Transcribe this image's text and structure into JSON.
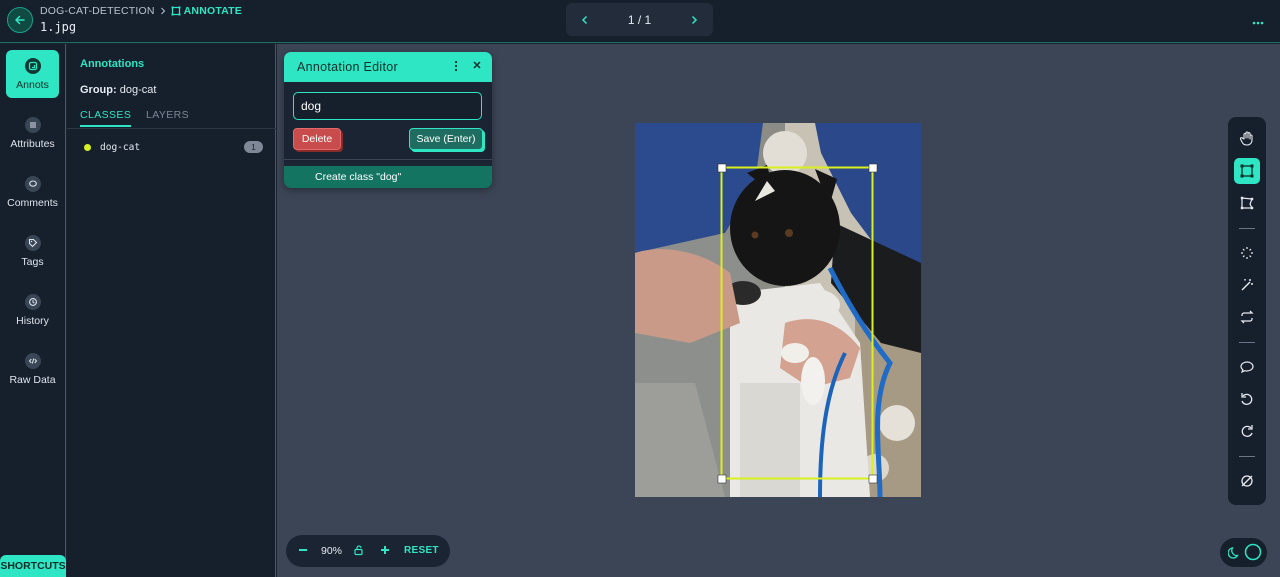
{
  "header": {
    "project": "DOG-CAT-DETECTION",
    "mode": "ANNOTATE",
    "filename": "1.jpg",
    "pager": "1 / 1"
  },
  "rail": {
    "items": [
      {
        "label": "Annots",
        "icon": "annotation-icon",
        "active": true
      },
      {
        "label": "Attributes",
        "icon": "list-icon"
      },
      {
        "label": "Comments",
        "icon": "comment-icon"
      },
      {
        "label": "Tags",
        "icon": "tag-icon"
      },
      {
        "label": "History",
        "icon": "history-icon"
      },
      {
        "label": "Raw Data",
        "icon": "code-icon"
      }
    ],
    "shortcuts": "SHORTCUTS"
  },
  "panel": {
    "title": "Annotations",
    "group_label": "Group:",
    "group_value": "dog-cat",
    "tab_classes": "CLASSES",
    "tab_layers": "LAYERS",
    "classes": [
      {
        "name": "dog-cat",
        "count": "1",
        "color": "#d9ef1f"
      }
    ]
  },
  "editor": {
    "title": "Annotation Editor",
    "input_value": "dog",
    "delete_label": "Delete",
    "save_label": "Save (Enter)",
    "create_label": "Create class \"dog\""
  },
  "zoom": {
    "value": "90%",
    "reset_label": "RESET"
  },
  "toolbar": {
    "tools": [
      "hand-icon",
      "bounding-box-icon",
      "polygon-icon",
      "magic-select-icon",
      "magic-wand-icon",
      "repeat-icon",
      "comment-icon",
      "undo-icon",
      "redo-icon",
      "hide-icon"
    ]
  },
  "colors": {
    "accent": "#2ee6c3",
    "bbox": "#d9ef1f",
    "delete": "#c94c4c"
  }
}
